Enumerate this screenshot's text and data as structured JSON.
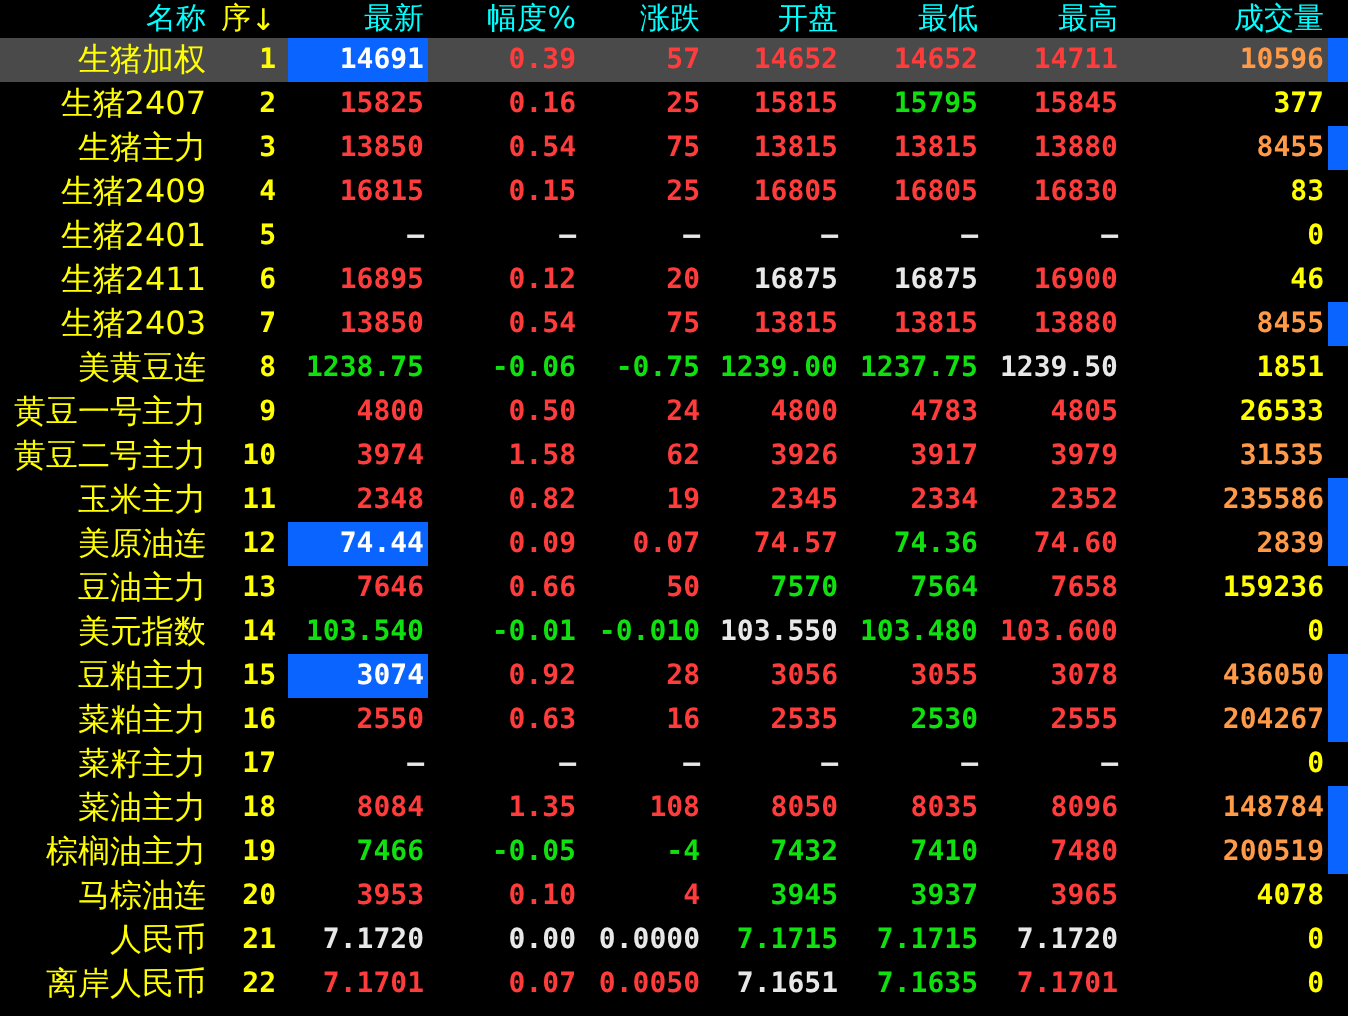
{
  "columns": [
    {
      "label": "名称"
    },
    {
      "label": "序",
      "sort_mark": "↓"
    },
    {
      "label": "最新"
    },
    {
      "label": "幅度%"
    },
    {
      "label": "涨跌"
    },
    {
      "label": "开盘"
    },
    {
      "label": "最低"
    },
    {
      "label": "最高"
    },
    {
      "label": "成交量"
    }
  ],
  "rows": [
    {
      "name": "生猪加权",
      "seq": "1",
      "selected": true,
      "marker": true,
      "cells": [
        {
          "text": "14691",
          "highlighted": true
        },
        {
          "text": "0.39",
          "color": "#ff3c3c"
        },
        {
          "text": "57",
          "color": "#ff3c3c"
        },
        {
          "text": "14652",
          "color": "#ff3c3c"
        },
        {
          "text": "14652",
          "color": "#ff3c3c"
        },
        {
          "text": "14711",
          "color": "#ff3c3c"
        },
        {
          "text": "10596",
          "color": "#ff9a48"
        }
      ]
    },
    {
      "name": "生猪2407",
      "seq": "2",
      "selected": false,
      "marker": false,
      "cells": [
        {
          "text": "15825",
          "color": "#ff3c3c"
        },
        {
          "text": "0.16",
          "color": "#ff3c3c"
        },
        {
          "text": "25",
          "color": "#ff3c3c"
        },
        {
          "text": "15815",
          "color": "#ff3c3c"
        },
        {
          "text": "15795",
          "color": "#10e010"
        },
        {
          "text": "15845",
          "color": "#ff3c3c"
        },
        {
          "text": "377",
          "color": "#ffff00"
        }
      ]
    },
    {
      "name": "生猪主力",
      "seq": "3",
      "selected": false,
      "marker": true,
      "cells": [
        {
          "text": "13850",
          "color": "#ff3c3c"
        },
        {
          "text": "0.54",
          "color": "#ff3c3c"
        },
        {
          "text": "75",
          "color": "#ff3c3c"
        },
        {
          "text": "13815",
          "color": "#ff3c3c"
        },
        {
          "text": "13815",
          "color": "#ff3c3c"
        },
        {
          "text": "13880",
          "color": "#ff3c3c"
        },
        {
          "text": "8455",
          "color": "#ff9a48"
        }
      ]
    },
    {
      "name": "生猪2409",
      "seq": "4",
      "selected": false,
      "marker": false,
      "cells": [
        {
          "text": "16815",
          "color": "#ff3c3c"
        },
        {
          "text": "0.15",
          "color": "#ff3c3c"
        },
        {
          "text": "25",
          "color": "#ff3c3c"
        },
        {
          "text": "16805",
          "color": "#ff3c3c"
        },
        {
          "text": "16805",
          "color": "#ff3c3c"
        },
        {
          "text": "16830",
          "color": "#ff3c3c"
        },
        {
          "text": "83",
          "color": "#ffff00"
        }
      ]
    },
    {
      "name": "生猪2401",
      "seq": "5",
      "selected": false,
      "marker": false,
      "cells": [
        {
          "text": "—",
          "color": "#e8e8e8"
        },
        {
          "text": "—",
          "color": "#e8e8e8"
        },
        {
          "text": "—",
          "color": "#e8e8e8"
        },
        {
          "text": "—",
          "color": "#e8e8e8"
        },
        {
          "text": "—",
          "color": "#e8e8e8"
        },
        {
          "text": "—",
          "color": "#e8e8e8"
        },
        {
          "text": "0",
          "color": "#ffff00"
        }
      ]
    },
    {
      "name": "生猪2411",
      "seq": "6",
      "selected": false,
      "marker": false,
      "cells": [
        {
          "text": "16895",
          "color": "#ff3c3c"
        },
        {
          "text": "0.12",
          "color": "#ff3c3c"
        },
        {
          "text": "20",
          "color": "#ff3c3c"
        },
        {
          "text": "16875",
          "color": "#e8e8e8"
        },
        {
          "text": "16875",
          "color": "#e8e8e8"
        },
        {
          "text": "16900",
          "color": "#ff3c3c"
        },
        {
          "text": "46",
          "color": "#ffff00"
        }
      ]
    },
    {
      "name": "生猪2403",
      "seq": "7",
      "selected": false,
      "marker": true,
      "cells": [
        {
          "text": "13850",
          "color": "#ff3c3c"
        },
        {
          "text": "0.54",
          "color": "#ff3c3c"
        },
        {
          "text": "75",
          "color": "#ff3c3c"
        },
        {
          "text": "13815",
          "color": "#ff3c3c"
        },
        {
          "text": "13815",
          "color": "#ff3c3c"
        },
        {
          "text": "13880",
          "color": "#ff3c3c"
        },
        {
          "text": "8455",
          "color": "#ff9a48"
        }
      ]
    },
    {
      "name": "美黄豆连",
      "seq": "8",
      "selected": false,
      "marker": false,
      "cells": [
        {
          "text": "1238.75",
          "color": "#10e010"
        },
        {
          "text": "-0.06",
          "color": "#10e010"
        },
        {
          "text": "-0.75",
          "color": "#10e010"
        },
        {
          "text": "1239.00",
          "color": "#10e010"
        },
        {
          "text": "1237.75",
          "color": "#10e010"
        },
        {
          "text": "1239.50",
          "color": "#e8e8e8"
        },
        {
          "text": "1851",
          "color": "#ffff00"
        }
      ]
    },
    {
      "name": "黄豆一号主力",
      "seq": "9",
      "selected": false,
      "marker": false,
      "cells": [
        {
          "text": "4800",
          "color": "#ff3c3c"
        },
        {
          "text": "0.50",
          "color": "#ff3c3c"
        },
        {
          "text": "24",
          "color": "#ff3c3c"
        },
        {
          "text": "4800",
          "color": "#ff3c3c"
        },
        {
          "text": "4783",
          "color": "#ff3c3c"
        },
        {
          "text": "4805",
          "color": "#ff3c3c"
        },
        {
          "text": "26533",
          "color": "#ffff00"
        }
      ]
    },
    {
      "name": "黄豆二号主力",
      "seq": "10",
      "selected": false,
      "marker": false,
      "cells": [
        {
          "text": "3974",
          "color": "#ff3c3c"
        },
        {
          "text": "1.58",
          "color": "#ff3c3c"
        },
        {
          "text": "62",
          "color": "#ff3c3c"
        },
        {
          "text": "3926",
          "color": "#ff3c3c"
        },
        {
          "text": "3917",
          "color": "#ff3c3c"
        },
        {
          "text": "3979",
          "color": "#ff3c3c"
        },
        {
          "text": "31535",
          "color": "#ff9a48"
        }
      ]
    },
    {
      "name": "玉米主力",
      "seq": "11",
      "selected": false,
      "marker": true,
      "cells": [
        {
          "text": "2348",
          "color": "#ff3c3c"
        },
        {
          "text": "0.82",
          "color": "#ff3c3c"
        },
        {
          "text": "19",
          "color": "#ff3c3c"
        },
        {
          "text": "2345",
          "color": "#ff3c3c"
        },
        {
          "text": "2334",
          "color": "#ff3c3c"
        },
        {
          "text": "2352",
          "color": "#ff3c3c"
        },
        {
          "text": "235586",
          "color": "#ff9a48"
        }
      ]
    },
    {
      "name": "美原油连",
      "seq": "12",
      "selected": false,
      "marker": true,
      "cells": [
        {
          "text": "74.44",
          "highlighted": true
        },
        {
          "text": "0.09",
          "color": "#ff3c3c"
        },
        {
          "text": "0.07",
          "color": "#ff3c3c"
        },
        {
          "text": "74.57",
          "color": "#ff3c3c"
        },
        {
          "text": "74.36",
          "color": "#10e010"
        },
        {
          "text": "74.60",
          "color": "#ff3c3c"
        },
        {
          "text": "2839",
          "color": "#ff9a48"
        }
      ]
    },
    {
      "name": "豆油主力",
      "seq": "13",
      "selected": false,
      "marker": false,
      "cells": [
        {
          "text": "7646",
          "color": "#ff3c3c"
        },
        {
          "text": "0.66",
          "color": "#ff3c3c"
        },
        {
          "text": "50",
          "color": "#ff3c3c"
        },
        {
          "text": "7570",
          "color": "#10e010"
        },
        {
          "text": "7564",
          "color": "#10e010"
        },
        {
          "text": "7658",
          "color": "#ff3c3c"
        },
        {
          "text": "159236",
          "color": "#ffff00"
        }
      ]
    },
    {
      "name": "美元指数",
      "seq": "14",
      "selected": false,
      "marker": false,
      "cells": [
        {
          "text": "103.540",
          "color": "#10e010"
        },
        {
          "text": "-0.01",
          "color": "#10e010"
        },
        {
          "text": "-0.010",
          "color": "#10e010"
        },
        {
          "text": "103.550",
          "color": "#e8e8e8"
        },
        {
          "text": "103.480",
          "color": "#10e010"
        },
        {
          "text": "103.600",
          "color": "#ff3c3c"
        },
        {
          "text": "0",
          "color": "#ffff00"
        }
      ]
    },
    {
      "name": "豆粕主力",
      "seq": "15",
      "selected": false,
      "marker": true,
      "cells": [
        {
          "text": "3074",
          "highlighted": true
        },
        {
          "text": "0.92",
          "color": "#ff3c3c"
        },
        {
          "text": "28",
          "color": "#ff3c3c"
        },
        {
          "text": "3056",
          "color": "#ff3c3c"
        },
        {
          "text": "3055",
          "color": "#ff3c3c"
        },
        {
          "text": "3078",
          "color": "#ff3c3c"
        },
        {
          "text": "436050",
          "color": "#ff9a48"
        }
      ]
    },
    {
      "name": "菜粕主力",
      "seq": "16",
      "selected": false,
      "marker": true,
      "cells": [
        {
          "text": "2550",
          "color": "#ff3c3c"
        },
        {
          "text": "0.63",
          "color": "#ff3c3c"
        },
        {
          "text": "16",
          "color": "#ff3c3c"
        },
        {
          "text": "2535",
          "color": "#ff3c3c"
        },
        {
          "text": "2530",
          "color": "#10e010"
        },
        {
          "text": "2555",
          "color": "#ff3c3c"
        },
        {
          "text": "204267",
          "color": "#ff9a48"
        }
      ]
    },
    {
      "name": "菜籽主力",
      "seq": "17",
      "selected": false,
      "marker": false,
      "cells": [
        {
          "text": "—",
          "color": "#e8e8e8"
        },
        {
          "text": "—",
          "color": "#e8e8e8"
        },
        {
          "text": "—",
          "color": "#e8e8e8"
        },
        {
          "text": "—",
          "color": "#e8e8e8"
        },
        {
          "text": "—",
          "color": "#e8e8e8"
        },
        {
          "text": "—",
          "color": "#e8e8e8"
        },
        {
          "text": "0",
          "color": "#ffff00"
        }
      ]
    },
    {
      "name": "菜油主力",
      "seq": "18",
      "selected": false,
      "marker": true,
      "cells": [
        {
          "text": "8084",
          "color": "#ff3c3c"
        },
        {
          "text": "1.35",
          "color": "#ff3c3c"
        },
        {
          "text": "108",
          "color": "#ff3c3c"
        },
        {
          "text": "8050",
          "color": "#ff3c3c"
        },
        {
          "text": "8035",
          "color": "#ff3c3c"
        },
        {
          "text": "8096",
          "color": "#ff3c3c"
        },
        {
          "text": "148784",
          "color": "#ff9a48"
        }
      ]
    },
    {
      "name": "棕榈油主力",
      "seq": "19",
      "selected": false,
      "marker": true,
      "cells": [
        {
          "text": "7466",
          "color": "#10e010"
        },
        {
          "text": "-0.05",
          "color": "#10e010"
        },
        {
          "text": "-4",
          "color": "#10e010"
        },
        {
          "text": "7432",
          "color": "#10e010"
        },
        {
          "text": "7410",
          "color": "#10e010"
        },
        {
          "text": "7480",
          "color": "#ff3c3c"
        },
        {
          "text": "200519",
          "color": "#ff9a48"
        }
      ]
    },
    {
      "name": "马棕油连",
      "seq": "20",
      "selected": false,
      "marker": false,
      "cells": [
        {
          "text": "3953",
          "color": "#ff3c3c"
        },
        {
          "text": "0.10",
          "color": "#ff3c3c"
        },
        {
          "text": "4",
          "color": "#ff3c3c"
        },
        {
          "text": "3945",
          "color": "#10e010"
        },
        {
          "text": "3937",
          "color": "#10e010"
        },
        {
          "text": "3965",
          "color": "#ff3c3c"
        },
        {
          "text": "4078",
          "color": "#ffff00"
        }
      ]
    },
    {
      "name": "人民币",
      "seq": "21",
      "selected": false,
      "marker": false,
      "cells": [
        {
          "text": "7.1720",
          "color": "#e8e8e8"
        },
        {
          "text": "0.00",
          "color": "#e8e8e8"
        },
        {
          "text": "0.0000",
          "color": "#e8e8e8"
        },
        {
          "text": "7.1715",
          "color": "#10e010"
        },
        {
          "text": "7.1715",
          "color": "#10e010"
        },
        {
          "text": "7.1720",
          "color": "#e8e8e8"
        },
        {
          "text": "0",
          "color": "#ffff00"
        }
      ]
    },
    {
      "name": "离岸人民币",
      "seq": "22",
      "selected": false,
      "marker": false,
      "cells": [
        {
          "text": "7.1701",
          "color": "#ff3c3c"
        },
        {
          "text": "0.07",
          "color": "#ff3c3c"
        },
        {
          "text": "0.0050",
          "color": "#ff3c3c"
        },
        {
          "text": "7.1651",
          "color": "#e8e8e8"
        },
        {
          "text": "7.1635",
          "color": "#10e010"
        },
        {
          "text": "7.1701",
          "color": "#ff3c3c"
        },
        {
          "text": "0",
          "color": "#ffff00"
        }
      ]
    }
  ]
}
